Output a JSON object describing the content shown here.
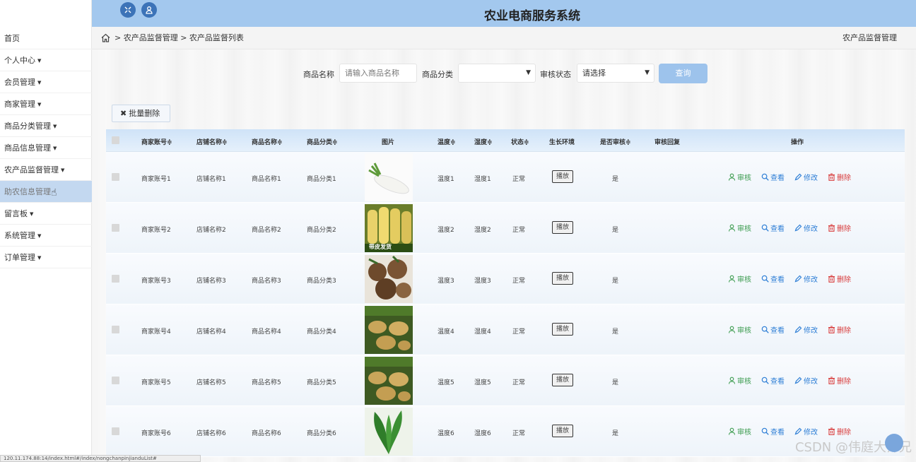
{
  "app": {
    "title": "农业电商服务系统"
  },
  "sidebar": {
    "items": [
      {
        "label": "首页",
        "caret": false,
        "active": false
      },
      {
        "label": "个人中心",
        "caret": true,
        "active": false
      },
      {
        "label": "会员管理",
        "caret": true,
        "active": false
      },
      {
        "label": "商家管理",
        "caret": true,
        "active": false
      },
      {
        "label": "商品分类管理",
        "caret": true,
        "active": false
      },
      {
        "label": "商品信息管理",
        "caret": true,
        "active": false
      },
      {
        "label": "农产品监督管理",
        "caret": true,
        "active": false
      },
      {
        "label": "助农信息管理",
        "caret": false,
        "active": true
      },
      {
        "label": "留言板",
        "caret": true,
        "active": false
      },
      {
        "label": "系统管理",
        "caret": true,
        "active": false
      },
      {
        "label": "订单管理",
        "caret": true,
        "active": false
      }
    ]
  },
  "breadcrumb": {
    "path": "> 农产品监督管理 > 农产品监督列表",
    "right": "农产品监督管理"
  },
  "search": {
    "name_label": "商品名称",
    "name_placeholder": "请输入商品名称",
    "category_label": "商品分类",
    "category_value": "",
    "status_label": "审核状态",
    "status_value": "请选择",
    "button": "查询"
  },
  "toolbar": {
    "batch_delete": "批量删除"
  },
  "table": {
    "headers": [
      "商家账号≑",
      "店铺名称≑",
      "商品名称≑",
      "商品分类≑",
      "图片",
      "温度≑",
      "湿度≑",
      "状态≑",
      "生长环境",
      "是否审核≑",
      "审核回复",
      "操作"
    ],
    "play_label": "播放",
    "actions": {
      "audit": "审核",
      "view": "查看",
      "edit": "修改",
      "delete": "删除"
    },
    "rows": [
      {
        "account": "商家账号1",
        "shop": "店铺名称1",
        "product": "商品名称1",
        "category": "商品分类1",
        "image": "radish",
        "temp": "温度1",
        "humidity": "湿度1",
        "status": "正常",
        "audited": "是",
        "reply": ""
      },
      {
        "account": "商家账号2",
        "shop": "店铺名称2",
        "product": "商品名称2",
        "category": "商品分类2",
        "image": "corn",
        "image_caption": "带皮发货",
        "temp": "温度2",
        "humidity": "湿度2",
        "status": "正常",
        "audited": "是",
        "reply": ""
      },
      {
        "account": "商家账号3",
        "shop": "店铺名称3",
        "product": "商品名称3",
        "category": "商品分类3",
        "image": "mushroom",
        "temp": "温度3",
        "humidity": "湿度3",
        "status": "正常",
        "audited": "是",
        "reply": ""
      },
      {
        "account": "商家账号4",
        "shop": "店铺名称4",
        "product": "商品名称4",
        "category": "商品分类4",
        "image": "potato",
        "temp": "温度4",
        "humidity": "湿度4",
        "status": "正常",
        "audited": "是",
        "reply": ""
      },
      {
        "account": "商家账号5",
        "shop": "店铺名称5",
        "product": "商品名称5",
        "category": "商品分类5",
        "image": "potato",
        "temp": "温度5",
        "humidity": "湿度5",
        "status": "正常",
        "audited": "是",
        "reply": ""
      },
      {
        "account": "商家账号6",
        "shop": "店铺名称6",
        "product": "商品名称6",
        "category": "商品分类6",
        "image": "greens",
        "temp": "温度6",
        "humidity": "湿度6",
        "status": "正常",
        "audited": "是",
        "reply": ""
      }
    ]
  },
  "statusbar": {
    "url": "120.11.174.88:14/index.html#/index/nongchanpinjianduList#"
  },
  "watermark": "CSDN @伟庭大师兄",
  "colors": {
    "header": "#a3c8ee",
    "accent": "#2f7fd6",
    "audit": "#3b9b4e",
    "delete": "#d83a3a"
  }
}
